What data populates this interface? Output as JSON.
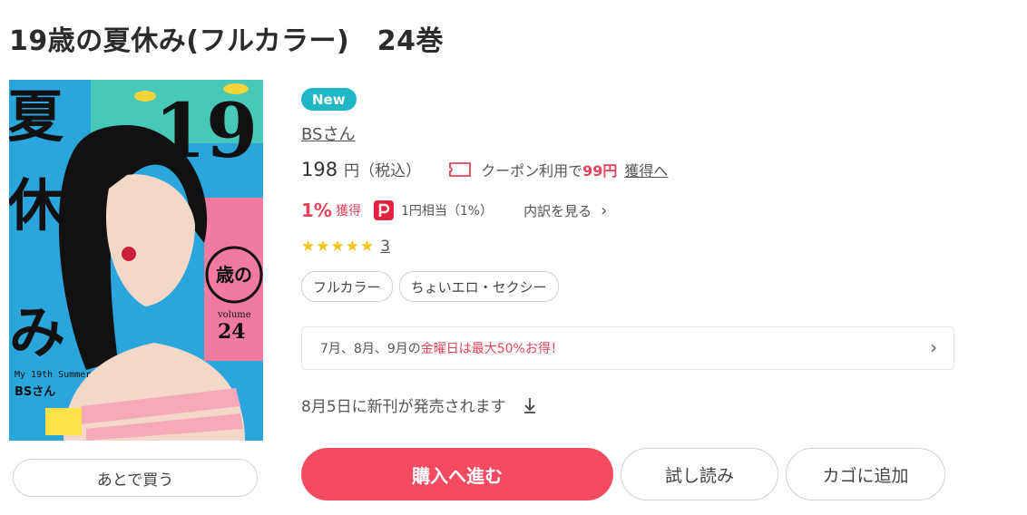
{
  "title": "19歳の夏休み(フルカラー)　24巻",
  "cover": {
    "title_vertical": "夏休み",
    "number": "19",
    "sai": "歳の",
    "volume_label": "volume",
    "volume_num": "24",
    "subtitle": "My 19th Summer",
    "author": "BSさん"
  },
  "later_button": "あとで買う",
  "badge": "New",
  "author": "BSさん",
  "price": {
    "amount": "198",
    "unit": "円（税込）"
  },
  "coupon": {
    "text": "クーポン利用で",
    "amount": "99円",
    "link": "獲得へ"
  },
  "points": {
    "percent": "1%",
    "label": "獲得",
    "equiv": "1円相当（1%）",
    "breakdown": "内訳を見る"
  },
  "rating": {
    "stars": 5,
    "count": "3"
  },
  "tags": [
    "フルカラー",
    "ちょいエロ・セクシー"
  ],
  "campaign": {
    "prefix": "7月、8月、9月の",
    "highlight": "金曜日は最大50%お得！"
  },
  "release": "8月5日に新刊が発売されます",
  "buttons": {
    "buy": "購入へ進む",
    "trial": "試し読み",
    "cart": "カゴに追加"
  },
  "colors": {
    "accent": "#f44b63",
    "badge": "#1fb7c6",
    "star": "#f5c518"
  }
}
